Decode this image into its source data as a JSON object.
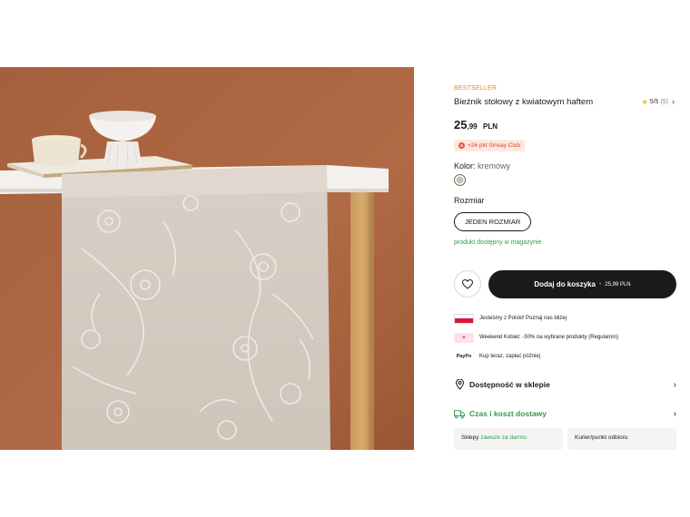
{
  "product": {
    "badge": "BESTSELLER",
    "title": "Bieżnik stołowy z kwiatowym haftem",
    "rating": {
      "score": "5/5",
      "count": "(5)"
    },
    "price": {
      "integer": "25",
      "decimal": ",99",
      "currency": "PLN"
    },
    "club_points": "+26 pkt Sinsay Club",
    "color": {
      "label": "Kolor:",
      "value": "kremowy",
      "swatch_hex": "#cdbfb4"
    },
    "size": {
      "label": "Rozmiar",
      "option": "JEDEN ROZMIAR"
    },
    "availability": "produkt dostępny w magazynie"
  },
  "actions": {
    "add_to_cart_label": "Dodaj do koszyka",
    "add_to_cart_separator": "-",
    "add_to_cart_price": "25,99 PLN",
    "wishlist_icon": "heart-icon"
  },
  "info": [
    {
      "icon": "poland-flag-icon",
      "text": "Jesteśmy z Polski! Poznaj nas bliżej"
    },
    {
      "icon": "pink-heart-icon",
      "text": "Weekend Kobiet: -30% na wybrane produkty (Regulamin)"
    },
    {
      "icon": "paypo-icon",
      "icon_text": "PayPo",
      "text": "Kup teraz, zapłać później"
    }
  ],
  "sections": {
    "store_availability": "Dostępność w sklepie",
    "delivery": "Czas i koszt dostawy"
  },
  "delivery_options": {
    "stores_label": "Sklepy",
    "stores_note": "zawsze za darmo",
    "courier_label": "Kurier/punkt odbioru"
  },
  "colors": {
    "accent_green": "#2e9b4f",
    "badge_orange": "#e8822a",
    "button_dark": "#1a1a1a"
  }
}
